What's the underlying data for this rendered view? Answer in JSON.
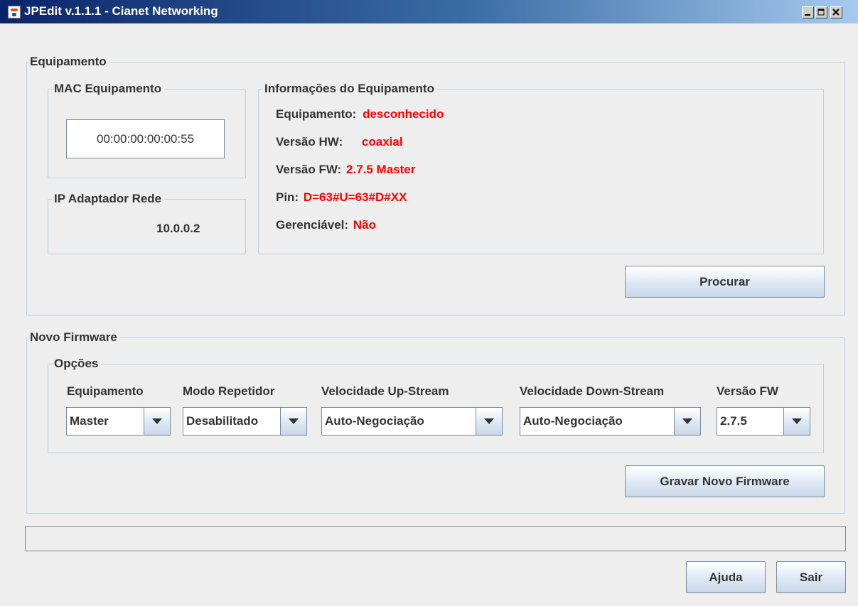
{
  "window": {
    "title": "JPEdit v.1.1.1 - Cianet Networking",
    "app_icon": "java-cup-icon",
    "controls": [
      "minimize-icon",
      "maximize-icon",
      "close-icon"
    ]
  },
  "equipamento": {
    "legend": "Equipamento",
    "mac": {
      "legend": "MAC Equipamento",
      "value": "00:00:00:00:00:55"
    },
    "ip": {
      "legend": "IP Adaptador Rede",
      "value": "10.0.0.2"
    },
    "info": {
      "legend": "Informações do Equipamento",
      "rows": [
        {
          "label": "Equipamento:",
          "value": "desconhecido"
        },
        {
          "label": "Versão HW:",
          "value": "coaxial"
        },
        {
          "label": "Versão FW:",
          "value": "2.7.5 Master"
        },
        {
          "label": "Pin:",
          "value": "D=63#U=63#D#XX"
        },
        {
          "label": "Gerenciável:",
          "value": "Não"
        }
      ]
    },
    "search_button": "Procurar"
  },
  "firmware": {
    "legend": "Novo Firmware",
    "options": {
      "legend": "Opções",
      "columns": [
        {
          "label": "Equipamento",
          "selected": "Master"
        },
        {
          "label": "Modo Repetidor",
          "selected": "Desabilitado"
        },
        {
          "label": "Velocidade Up-Stream",
          "selected": "Auto-Negociação"
        },
        {
          "label": "Velocidade Down-Stream",
          "selected": "Auto-Negociação"
        },
        {
          "label": "Versão FW",
          "selected": "2.7.5"
        }
      ]
    },
    "write_button": "Gravar Novo Firmware"
  },
  "progress": {
    "value": 0
  },
  "footer": {
    "help_button": "Ajuda",
    "exit_button": "Sair"
  },
  "colors": {
    "value_red": "#ff0000",
    "border_blue": "#b8cfe5",
    "title_start": "#0a246a",
    "title_end": "#a6caf0"
  }
}
